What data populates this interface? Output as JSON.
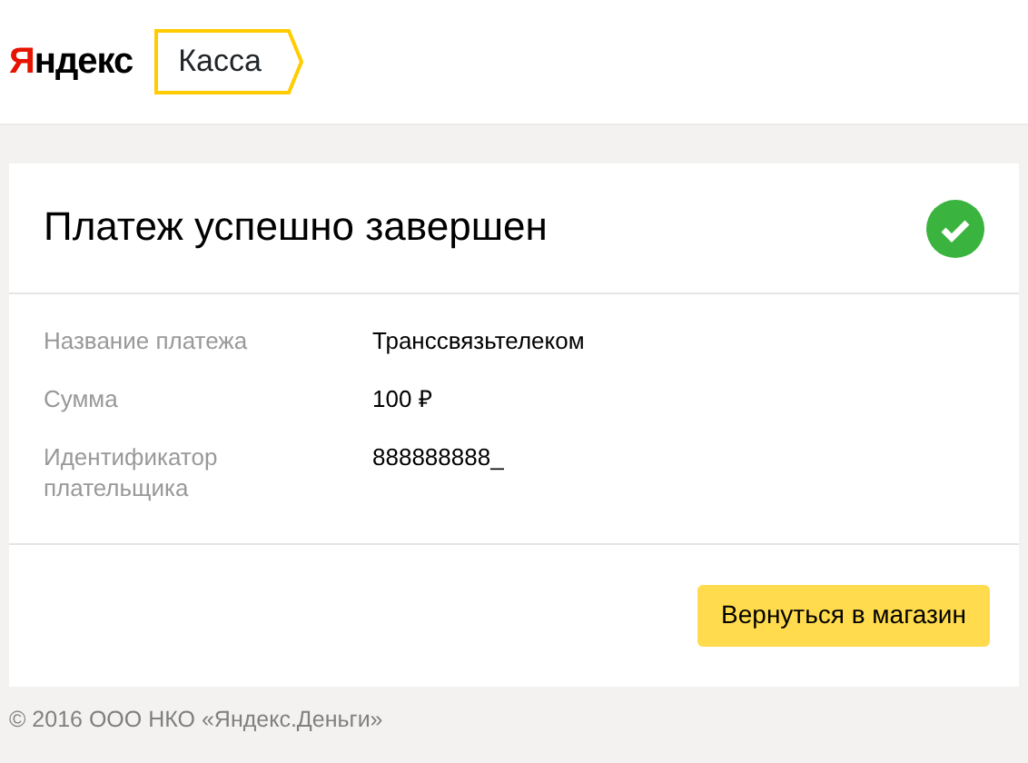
{
  "header": {
    "logo": {
      "accent": "Я",
      "rest": "ндекс"
    },
    "service": "Касса"
  },
  "card": {
    "title": "Платеж успешно завершен",
    "success": true,
    "details": [
      {
        "label": "Название платежа",
        "value": "Транссвязьтелеком"
      },
      {
        "label": "Сумма",
        "value": "100 ₽"
      },
      {
        "label": "Идентификатор плательщика",
        "value": "888888888_"
      }
    ],
    "button": "Вернуться в магазин"
  },
  "footer": "© 2016 ООО НКО «Яндекс.Деньги»"
}
